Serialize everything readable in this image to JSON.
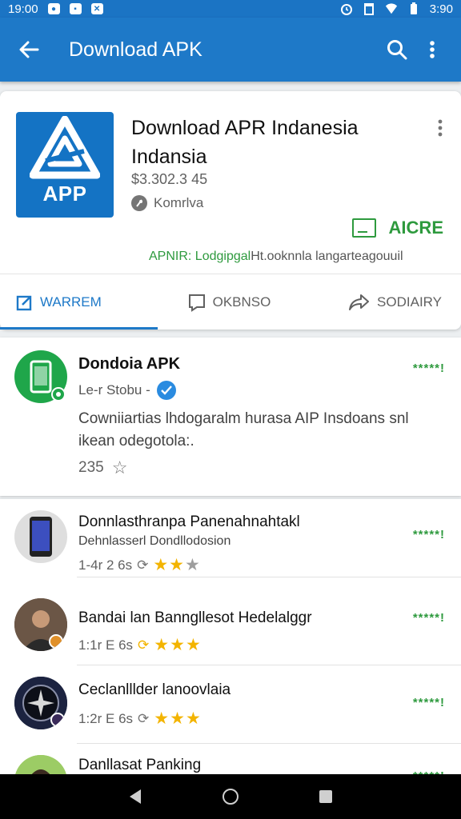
{
  "status_bar": {
    "time": "19:00",
    "time_right": "3:90"
  },
  "app_bar": {
    "title": "Download APK"
  },
  "main_card": {
    "icon_label": "APP",
    "title": "Download APR Indanesia Indansia",
    "price": "$3.302.3 45",
    "developer": "Komrlva",
    "install_label": "AICRE",
    "green_line_a": "APNIR: Lodgipgal",
    "green_line_b": "Ht.ooknnla langarteagouuil",
    "tabs": [
      {
        "label": "WARREM",
        "icon": "edit-square-icon"
      },
      {
        "label": "OKBNSO",
        "icon": "comment-icon"
      },
      {
        "label": "SODIAIRY",
        "icon": "share-icon"
      }
    ]
  },
  "featured": {
    "name": "Dondoia APK",
    "sub": "Le-r Stobu -",
    "description": "Cowniiartias lhdogaralm hurasa AIP Insdoans snl ikean odegotola:.",
    "count": "235",
    "rating_text": "*****!"
  },
  "list": [
    {
      "title": "Donnlasthranpa Panenahnahtakl",
      "sub": "Dehnlasserl Dondllodosion",
      "meta": "1-4r  2 6s",
      "stars": "★★",
      "half": "★",
      "rating_text": "*****!"
    },
    {
      "title": "Bandai lan Banngllesot Hedelalggr",
      "sub": "",
      "meta": "1:1r  E 6s",
      "stars": "★★★",
      "half": "",
      "rating_text": "*****!"
    },
    {
      "title": "Ceclanlllder lanoovlaia",
      "sub": "",
      "meta": "1:2r  E 6s",
      "stars": "★★★",
      "half": "",
      "rating_text": "*****!"
    },
    {
      "title": "Danllasat Panking",
      "sub": "",
      "meta": "",
      "stars": "",
      "half": "",
      "rating_text": "*****!"
    }
  ]
}
